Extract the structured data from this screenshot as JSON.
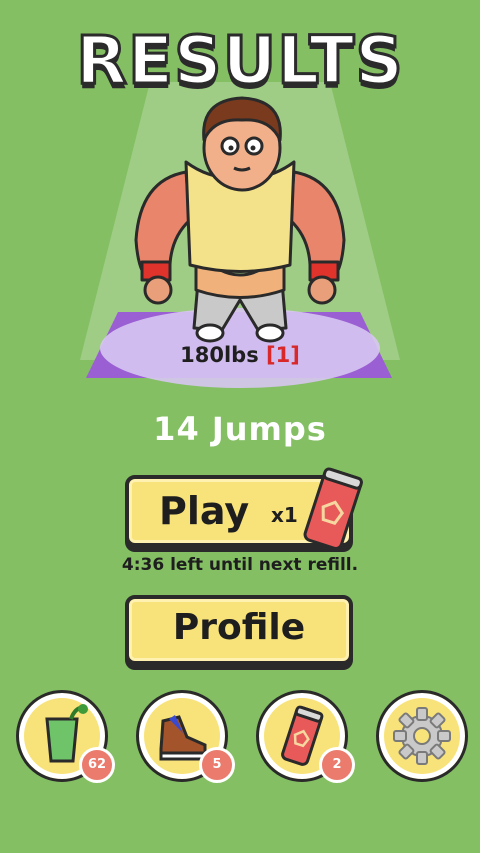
{
  "screen": {
    "title": "RESULTS",
    "background_color": "#84bf64"
  },
  "result": {
    "weight": "180lbs",
    "level": "[1]",
    "jumps": "14 Jumps"
  },
  "play_button": {
    "label": "Play",
    "multiplier": "x1"
  },
  "refill_text": "4:36 left until next refill.",
  "profile_button": {
    "label": "Profile"
  },
  "shop_items": [
    {
      "name": "smoothie",
      "icon": "green-drink-icon",
      "count": "62"
    },
    {
      "name": "sneakers",
      "icon": "sneaker-icon",
      "count": "5"
    },
    {
      "name": "energy-can",
      "icon": "energy-can-icon",
      "count": "2"
    },
    {
      "name": "settings",
      "icon": "gear-icon"
    }
  ],
  "colors": {
    "button_fill": "#f8e27a",
    "badge": "#ea7b6d",
    "mat": "#c9a7f0",
    "can": "#e85a5a"
  }
}
